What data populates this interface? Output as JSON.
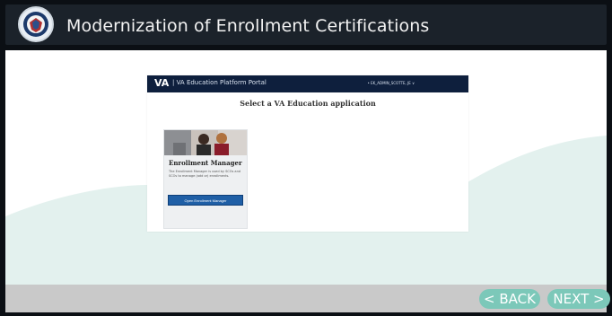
{
  "header": {
    "title": "Modernization of Enrollment Certifications",
    "seal_icon": "va-seal-icon"
  },
  "portal": {
    "logo": "VA",
    "name": "| VA Education Platform Portal",
    "user": "• EK_ADMIN_SCOTTE, JE  ∨",
    "heading": "Select a VA Education application",
    "card": {
      "title": "Enrollment Manager",
      "description": "The Enrollment Manager is used by SCOs and SCOs to manage (add or) enrollments.",
      "button": "Open Enrollment Manager"
    }
  },
  "footer": {
    "back_label": "< BACK",
    "next_label": "NEXT >"
  },
  "colors": {
    "portal_bar": "#0e1f3d",
    "nav_button": "#7cc8b9",
    "card_button": "#1f5fa6",
    "wave": "#e3f1ee"
  }
}
